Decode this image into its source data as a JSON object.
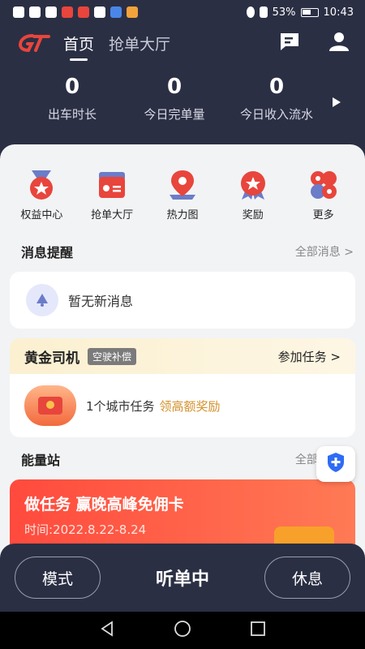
{
  "statusbar": {
    "battery": "53%",
    "time": "10:43"
  },
  "header": {
    "tab_home": "首页",
    "tab_orders": "抢单大厅"
  },
  "stats": [
    {
      "value": "0",
      "label": "出车时长"
    },
    {
      "value": "0",
      "label": "今日完单量"
    },
    {
      "value": "0",
      "label": "今日收入流水"
    }
  ],
  "grid": [
    {
      "label": "权益中心",
      "icon": "medal-icon"
    },
    {
      "label": "抢单大厅",
      "icon": "order-card-icon"
    },
    {
      "label": "热力图",
      "icon": "map-pin-icon"
    },
    {
      "label": "奖励",
      "icon": "star-badge-icon"
    },
    {
      "label": "更多",
      "icon": "more-apps-icon"
    }
  ],
  "messages": {
    "title": "消息提醒",
    "more": "全部消息 >",
    "empty": "暂无新消息"
  },
  "gold": {
    "title": "黄金司机",
    "tag": "空驶补偿",
    "join": "参加任务 >",
    "task": "1个城市任务",
    "reward": "领高额奖励"
  },
  "energy": {
    "title": "能量站",
    "more": "全部活动 >"
  },
  "banner": {
    "title": "做任务 赢晚高峰免佣卡",
    "date": "时间:2022.8.22-8.24"
  },
  "bottom": {
    "mode": "模式",
    "status": "听单中",
    "rest": "休息"
  },
  "colors": {
    "bg_dark": "#2b2f44",
    "accent_red": "#e8453c",
    "gold_text": "#d4902c"
  }
}
